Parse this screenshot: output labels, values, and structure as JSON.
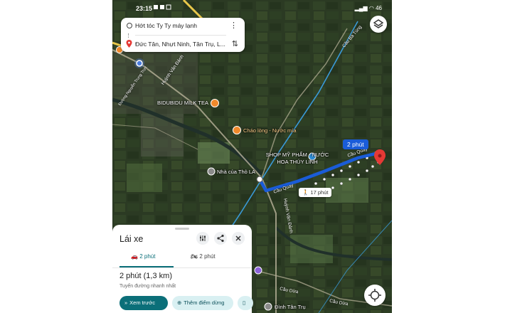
{
  "status_bar": {
    "time": "23:15",
    "battery": "46"
  },
  "route_card": {
    "origin": "Hớt tóc Ty Ty máy lạnh",
    "destination": "Đức Tân, Nhựt Ninh, Tân Trụ, L..."
  },
  "map": {
    "places": [
      {
        "name": "BIDUBIDU MILK TEA"
      },
      {
        "name": "Cháo lòng - Nước mía"
      },
      {
        "name": "SHOP MỸ PHẨM - NƯỚC HOA THÚY LINH"
      },
      {
        "name": "Nhà của Thỏ LA"
      },
      {
        "name": "Đình Tân Trụ"
      }
    ],
    "roads": [
      "Cầu Quay",
      "Cầu Quay",
      "Huỳnh Văn Đảnh",
      "Huỳnh Văn Đảnh",
      "Đường Nguyễn Trung Trực",
      "Cầu Bà Tùng",
      "Cầu Dừa",
      "Cầu Dừa"
    ],
    "driving_time_badge": "2 phút",
    "walking_time_badge": "17 phút",
    "colors": {
      "route": "#1a5cd8",
      "accent": "#0b6f79",
      "pin": "#e53935"
    }
  },
  "sheet": {
    "title": "Lái xe",
    "tabs": [
      {
        "label": "2 phút",
        "icon": "car-icon",
        "active": true
      },
      {
        "label": "2 phút",
        "icon": "motorbike-icon",
        "active": false
      }
    ],
    "summary": "2 phút (1,3 km)",
    "subtitle": "Tuyến đường nhanh nhất",
    "actions": {
      "preview": "Xem trước",
      "add_stop": "Thêm điểm dừng"
    }
  }
}
